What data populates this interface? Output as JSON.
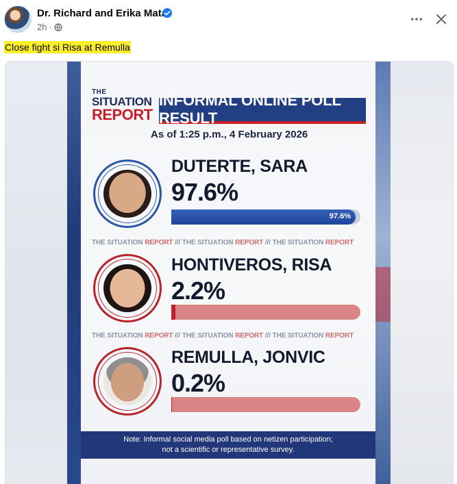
{
  "post": {
    "author": "Dr. Richard and Erika Mata",
    "time": "2h",
    "separator": "·",
    "caption": "Close fight si Risa at Remulla"
  },
  "icons": {
    "verified": "verified-badge-icon",
    "audience": "globe-icon",
    "more": "more-options-icon",
    "close": "close-icon"
  },
  "colors": {
    "caption_highlight": "#ffef2a",
    "brand_blue": "#233f84",
    "brand_red": "#c8202b",
    "verified": "#1877f2"
  },
  "poll": {
    "logo_the": "THE",
    "logo_situation": "SITUATION",
    "logo_report": "REPORT",
    "title": "INFORMAL ONLINE POLL RESULT",
    "as_of": "As of 1:25 p.m., 4 February 2026",
    "divider": {
      "a": "THE SITUATION ",
      "b": "REPORT",
      "sep": " /// "
    },
    "candidates": [
      {
        "name": "DUTERTE, SARA",
        "percent_label": "97.6%",
        "percent": 97.6,
        "bar_label": "97.6%"
      },
      {
        "name": "HONTIVEROS, RISA",
        "percent_label": "2.2%",
        "percent": 2.2
      },
      {
        "name": "REMULLA, JONVIC",
        "percent_label": "0.2%",
        "percent": 0.2
      }
    ],
    "note_line1": "Note: Informal social media poll based on netizen participation;",
    "note_line2": "not a scientific or representative survey."
  }
}
